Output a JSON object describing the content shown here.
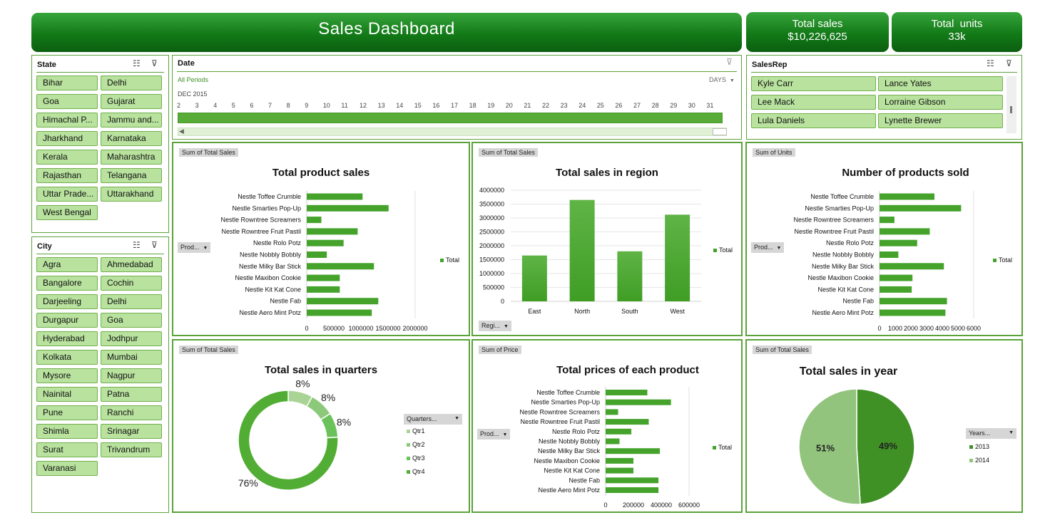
{
  "header": {
    "title": "Sales Dashboard"
  },
  "kpis": [
    {
      "label": "Total sales",
      "value": "$10,226,625"
    },
    {
      "label": "Total  units",
      "value": "33k"
    }
  ],
  "state_slicer": {
    "title": "State",
    "items": [
      "Bihar",
      "Delhi",
      "Goa",
      "Gujarat",
      "Himachal P...",
      "Jammu and...",
      "Jharkhand",
      "Karnataka",
      "Kerala",
      "Maharashtra",
      "Rajasthan",
      "Telangana",
      "Uttar Prade...",
      "Uttarakhand",
      "West Bengal"
    ]
  },
  "city_slicer": {
    "title": "City",
    "items": [
      "Agra",
      "Ahmedabad",
      "Bangalore",
      "Cochin",
      "Darjeeling",
      "Delhi",
      "Durgapur",
      "Goa",
      "Hyderabad",
      "Jodhpur",
      "Kolkata",
      "Mumbai",
      "Mysore",
      "Nagpur",
      "Nainital",
      "Patna",
      "Pune",
      "Ranchi",
      "Shimla",
      "Srinagar",
      "Surat",
      "Trivandrum",
      "Varanasi"
    ]
  },
  "date_timeline": {
    "title": "Date",
    "period_label": "All Periods",
    "level": "DAYS",
    "month_label": "DEC 2015",
    "days": [
      "2",
      "3",
      "4",
      "5",
      "6",
      "7",
      "8",
      "9",
      "10",
      "11",
      "12",
      "13",
      "14",
      "15",
      "16",
      "17",
      "18",
      "19",
      "20",
      "21",
      "22",
      "23",
      "24",
      "25",
      "26",
      "27",
      "28",
      "29",
      "30",
      "31"
    ]
  },
  "salesrep_slicer": {
    "title": "SalesRep",
    "items": [
      "Kyle Carr",
      "Lance Yates",
      "Lee Mack",
      "Lorraine Gibson",
      "Lula Daniels",
      "Lynette Brewer"
    ]
  },
  "colors": {
    "accent": "#4ea82a",
    "bar": "#45a32c",
    "border": "#5aa33a",
    "slicer_fill": "#b8e29e",
    "pie_2013": "#3f9025",
    "pie_2014": "#93c47d"
  },
  "chart_data": [
    {
      "id": "product_sales",
      "type": "bar",
      "orientation": "horizontal",
      "field_tag": "Sum of Total Sales",
      "title": "Total product sales",
      "filter_button": "Prod...",
      "categories": [
        "Nestle Toffee Crumble",
        "Nestle Smarties Pop-Up",
        "Nestle Rowntree Screamers",
        "Nestle Rowntree Fruit Pastil",
        "Nestle Rolo Potz",
        "Nestle Nobbly Bobbly",
        "Nestle Milky Bar Stick",
        "Nestle Maxibon Cookie",
        "Nestle Kit Kat Cone",
        "Nestle Fab",
        "Nestle Aero Mint Potz"
      ],
      "series": [
        {
          "name": "Total",
          "values": [
            1030000,
            1510000,
            270000,
            940000,
            680000,
            370000,
            1240000,
            610000,
            610000,
            1320000,
            1200000
          ]
        }
      ],
      "xlim": [
        0,
        2000000
      ],
      "ticks": [
        "0",
        "500000",
        "1000000",
        "1500000",
        "2000000"
      ],
      "legend": "right"
    },
    {
      "id": "region_sales",
      "type": "bar",
      "orientation": "vertical",
      "field_tag": "Sum of Total Sales",
      "title": "Total sales in region",
      "filter_button": "Regi...",
      "categories": [
        "East",
        "North",
        "South",
        "West"
      ],
      "series": [
        {
          "name": "Total",
          "values": [
            1650000,
            3650000,
            1800000,
            3120000
          ]
        }
      ],
      "ylim": [
        0,
        4000000
      ],
      "ticks": [
        "0",
        "500000",
        "1000000",
        "1500000",
        "2000000",
        "2500000",
        "3000000",
        "3500000",
        "4000000"
      ],
      "grid": true,
      "legend": "right"
    },
    {
      "id": "products_sold",
      "type": "bar",
      "orientation": "horizontal",
      "field_tag": "Sum of Units",
      "title": "Number of products sold",
      "filter_button": "Prod...",
      "categories": [
        "Nestle Toffee Crumble",
        "Nestle Smarties Pop-Up",
        "Nestle Rowntree Screamers",
        "Nestle Rowntree Fruit Pastil",
        "Nestle Rolo Potz",
        "Nestle Nobbly Bobbly",
        "Nestle Milky Bar Stick",
        "Nestle Maxibon Cookie",
        "Nestle Kit Kat Cone",
        "Nestle Fab",
        "Nestle Aero Mint Potz"
      ],
      "series": [
        {
          "name": "Total",
          "values": [
            3500,
            5200,
            950,
            3200,
            2400,
            1200,
            4100,
            2100,
            2050,
            4300,
            4200
          ]
        }
      ],
      "xlim": [
        0,
        6000
      ],
      "ticks": [
        "0",
        "1000",
        "2000",
        "3000",
        "4000",
        "5000",
        "6000"
      ],
      "legend": "right"
    },
    {
      "id": "quarter_sales",
      "type": "pie",
      "variant": "doughnut",
      "field_tag": "Sum of Total Sales",
      "title": "Total sales in quarters",
      "filter_button": "Quarters...",
      "categories": [
        "Qtr1",
        "Qtr2",
        "Qtr3",
        "Qtr4"
      ],
      "values": [
        8,
        8,
        8,
        76
      ],
      "labels": [
        "8%",
        "8%",
        "8%",
        "76%"
      ],
      "colors": [
        "#a9d496",
        "#8dc97a",
        "#6cc25a",
        "#52ad34"
      ],
      "legend": "right"
    },
    {
      "id": "product_prices",
      "type": "bar",
      "orientation": "horizontal",
      "field_tag": "Sum of Price",
      "title": "Total prices of each product",
      "filter_button": "Prod...",
      "categories": [
        "Nestle Toffee Crumble",
        "Nestle Smarties Pop-Up",
        "Nestle Rowntree Screamers",
        "Nestle Rowntree Fruit Pastil",
        "Nestle Rolo Potz",
        "Nestle Nobbly Bobbly",
        "Nestle Milky Bar Stick",
        "Nestle Maxibon Cookie",
        "Nestle Kit Kat Cone",
        "Nestle Fab",
        "Nestle Aero Mint Potz"
      ],
      "series": [
        {
          "name": "Total",
          "values": [
            300000,
            470000,
            90000,
            310000,
            185000,
            100000,
            390000,
            200000,
            200000,
            380000,
            380000
          ]
        }
      ],
      "xlim": [
        0,
        600000
      ],
      "ticks": [
        "0",
        "200000",
        "400000",
        "600000"
      ],
      "legend": "right"
    },
    {
      "id": "year_sales",
      "type": "pie",
      "field_tag": "Sum of Total Sales",
      "title": "Total sales in year",
      "filter_button": "Years...",
      "categories": [
        "2013",
        "2014"
      ],
      "values": [
        49,
        51
      ],
      "labels": [
        "49%",
        "51%"
      ],
      "colors": [
        "#3f9025",
        "#93c47d"
      ],
      "legend": "right"
    }
  ]
}
